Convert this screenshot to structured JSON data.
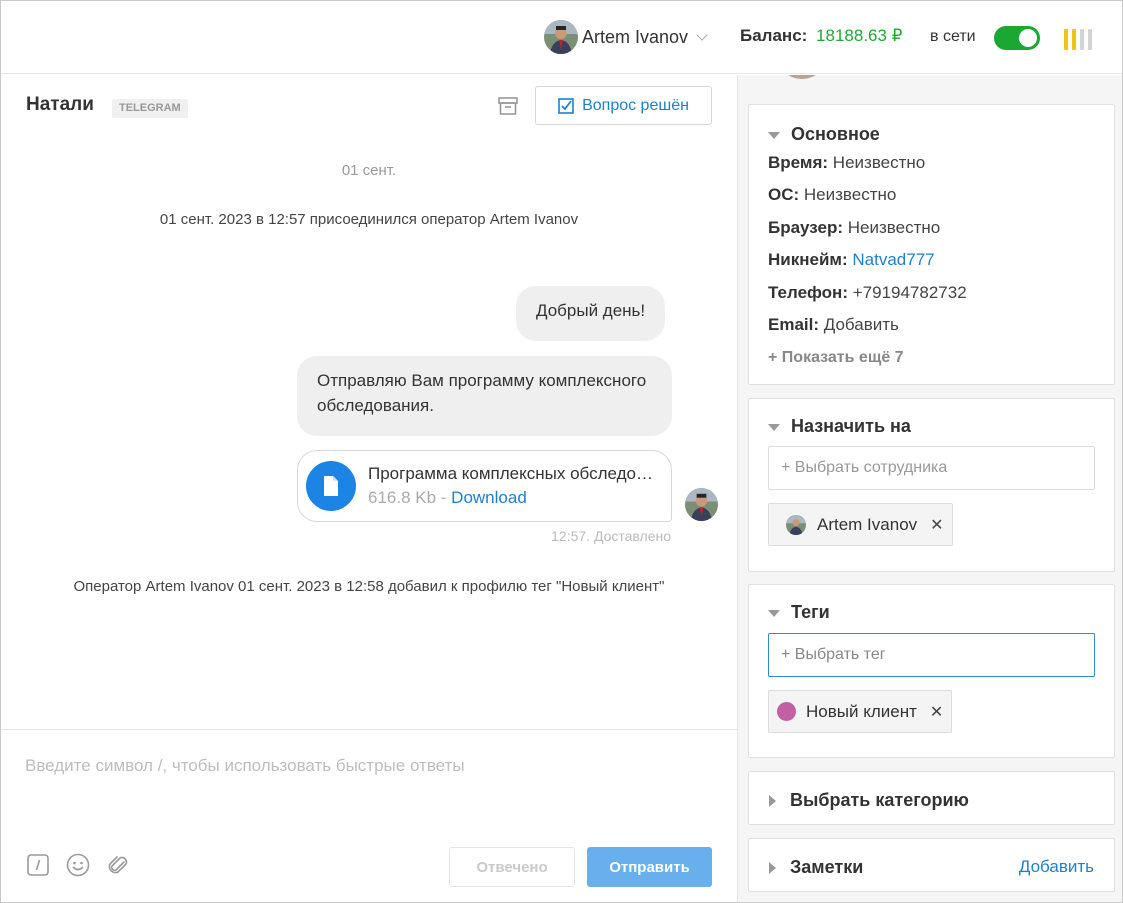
{
  "topbar": {
    "user_name": "Artem Ivanov",
    "balance_label": "Баланс:",
    "balance_value": "18188.63 ₽",
    "online_label": "в сети",
    "online": true,
    "colors": {
      "balance": "#1ea931",
      "toggle": "#1ba832"
    },
    "signal_bars": [
      "#f1c40f",
      "#f1c40f",
      "#d3d3d3",
      "#d3d3d3"
    ]
  },
  "chat": {
    "contact_name": "Натали",
    "channel_badge": "TELEGRAM",
    "resolved_label": "Вопрос решён",
    "date_separator": "01 сент.",
    "operator_joined": "01 сент. 2023 в 12:57 присоединился оператор Artem Ivanov",
    "messages": [
      {
        "text": "Добрый день!"
      },
      {
        "text": "Отправляю Вам программу комплексного обследования."
      }
    ],
    "file": {
      "name": "Программа комплексных обследований",
      "size": "616.8 Kb",
      "separator": " - ",
      "download_label": "Download"
    },
    "message_status": "12:57. Доставлено",
    "tag_note": "Оператор Artem Ivanov 01 сент. 2023 в 12:58 добавил к профилю тег \"Новый клиент\""
  },
  "composer": {
    "placeholder": "Введите символ /, чтобы использовать быстрые ответы",
    "answered_label": "Отвечено",
    "send_label": "Отправить"
  },
  "sidebar": {
    "basic": {
      "title": "Основное",
      "fields": [
        {
          "label": "Время:",
          "value": "Неизвестно"
        },
        {
          "label": "ОС:",
          "value": "Неизвестно"
        },
        {
          "label": "Браузер:",
          "value": "Неизвестно"
        },
        {
          "label": "Никнейм:",
          "value": "Natvad777"
        },
        {
          "label": "Телефон:",
          "value": "+79194782732"
        },
        {
          "label": "Email:",
          "value": "Добавить"
        }
      ],
      "show_more": "+ Показать ещё 7"
    },
    "assign": {
      "title": "Назначить на",
      "placeholder": "+ Выбрать сотрудника",
      "assignee": "Artem Ivanov"
    },
    "tags": {
      "title": "Теги",
      "placeholder": "+ Выбрать тег",
      "tag_name": "Новый клиент",
      "tag_color": "#c35fa5"
    },
    "category": {
      "title": "Выбрать категорию"
    },
    "notes": {
      "title": "Заметки",
      "add_label": "Добавить"
    }
  }
}
